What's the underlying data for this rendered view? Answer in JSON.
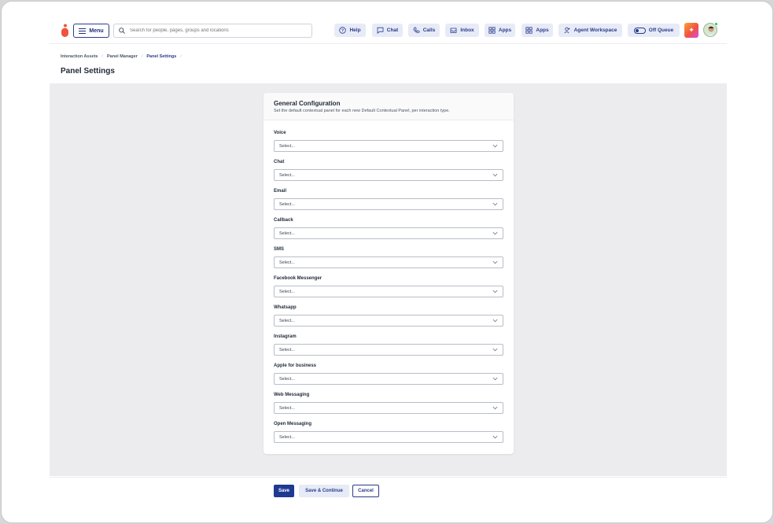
{
  "topbar": {
    "menu_label": "Menu",
    "search_placeholder": "Search for people, pages, groups and locations",
    "help_label": "Help",
    "chat_label": "Chat",
    "calls_label": "Calls",
    "inbox_label": "Inbox",
    "apps1_label": "Apps",
    "apps2_label": "Apps",
    "workspace_label": "Agent Workspace",
    "queue_label": "Off Queue",
    "accent": "#2a3a8a",
    "logo_color": "#f0533f"
  },
  "breadcrumb": [
    "Interaction Assets",
    "Panel Manager",
    "Panel Settings"
  ],
  "page_title": "Panel Settings",
  "card": {
    "title": "General Configuration",
    "subtitle": "Set the default contextual panel for each new Default Contextual Panel, per interaction type.",
    "fields": [
      {
        "label": "Voice",
        "value": "Select..."
      },
      {
        "label": "Chat",
        "value": "Select..."
      },
      {
        "label": "Email",
        "value": "Select..."
      },
      {
        "label": "Callback",
        "value": "Select..."
      },
      {
        "label": "SMS",
        "value": "Select..."
      },
      {
        "label": "Facebook Messenger",
        "value": "Select..."
      },
      {
        "label": "Whatsapp",
        "value": "Select..."
      },
      {
        "label": "Instagram",
        "value": "Select..."
      },
      {
        "label": "Apple for business",
        "value": "Select..."
      },
      {
        "label": "Web Messaging",
        "value": "Select..."
      },
      {
        "label": "Open Messaging",
        "value": "Select..."
      }
    ]
  },
  "footer": {
    "save_label": "Save",
    "save_continue_label": "Save & Continue",
    "cancel_label": "Cancel"
  }
}
